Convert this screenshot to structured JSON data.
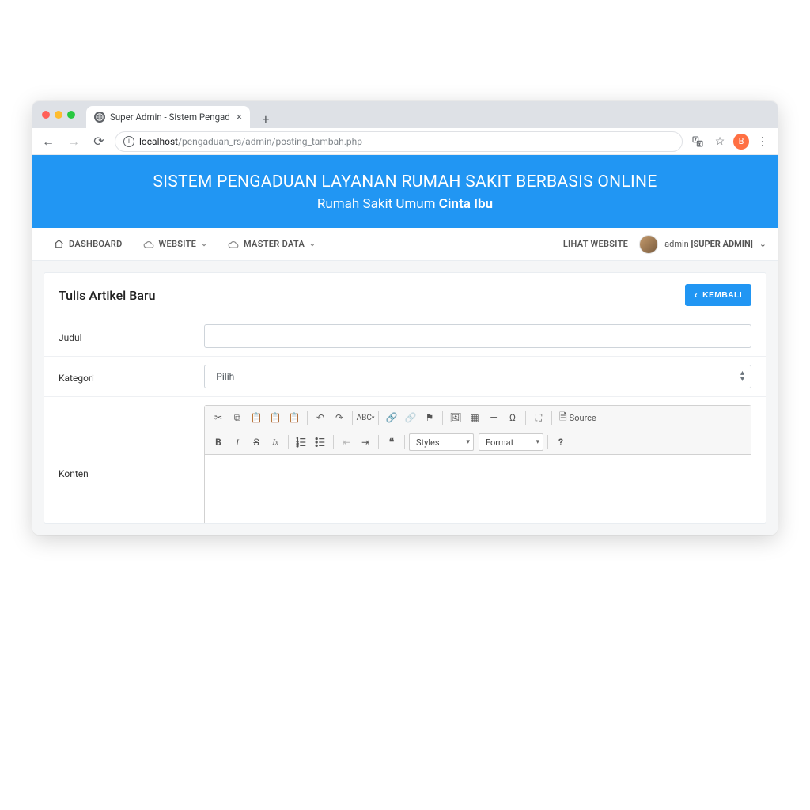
{
  "browser": {
    "tab_title": "Super Admin - Sistem Pengadu",
    "url_host": "localhost",
    "url_path": "/pengaduan_rs/admin/posting_tambah.php",
    "avatar_initial": "B"
  },
  "banner": {
    "title": "SISTEM PENGADUAN LAYANAN RUMAH SAKIT BERBASIS ONLINE",
    "subtitle_prefix": "Rumah Sakit Umum ",
    "subtitle_bold": "Cinta Ibu"
  },
  "nav": {
    "dashboard": "DASHBOARD",
    "website": "WEBSITE",
    "master_data": "MASTER DATA",
    "lihat_website": "LIHAT WEBSITE",
    "user_name": "admin ",
    "user_role": "[SUPER ADMIN]"
  },
  "page": {
    "title": "Tulis Artikel Baru",
    "back_btn": "KEMBALI"
  },
  "form": {
    "judul_label": "Judul",
    "kategori_label": "Kategori",
    "kategori_placeholder": "- Pilih -",
    "konten_label": "Konten",
    "styles_label": "Styles",
    "format_label": "Format",
    "source_label": "Source"
  }
}
